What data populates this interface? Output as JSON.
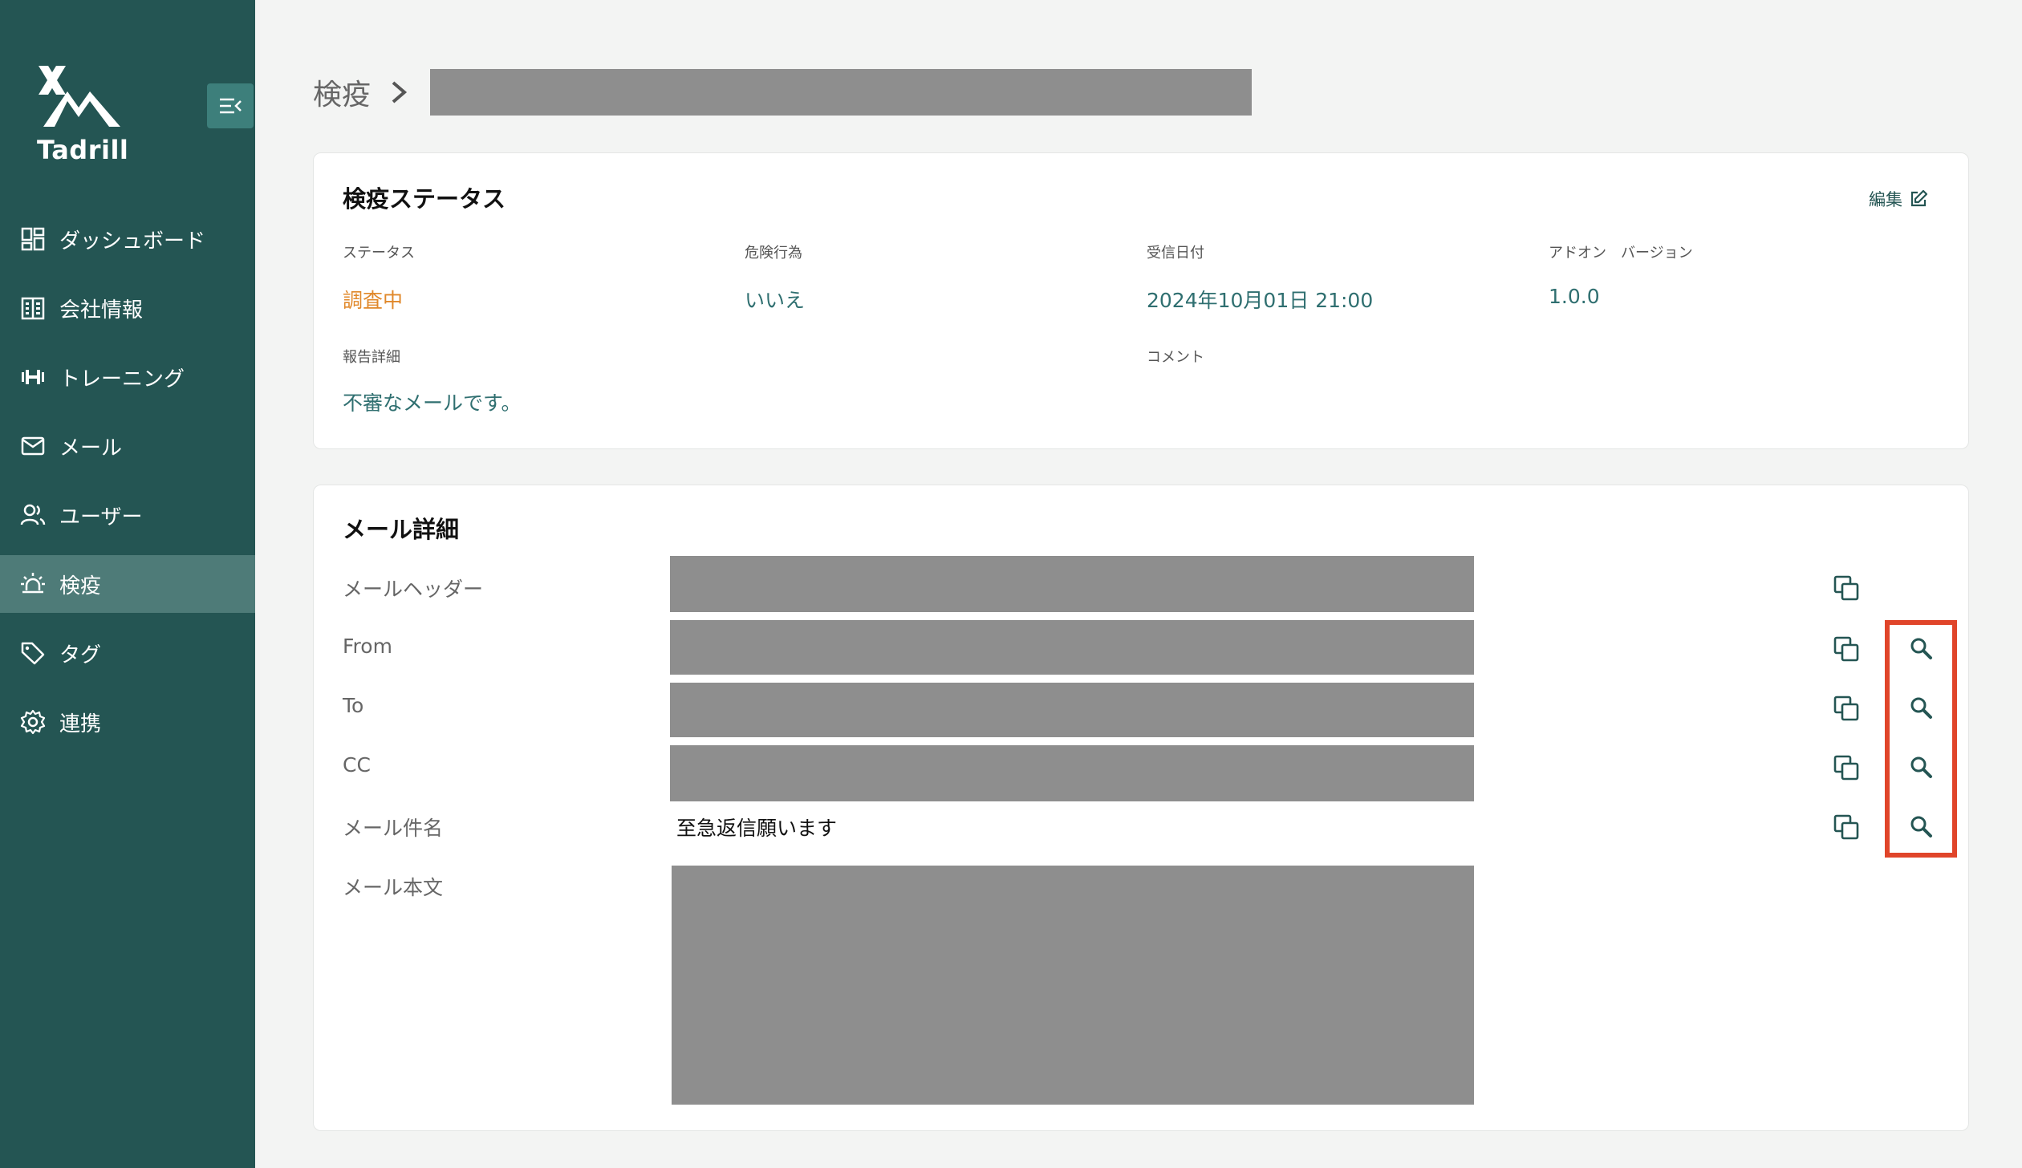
{
  "app": {
    "logo_text": "Tadrill"
  },
  "sidebar": {
    "items": [
      {
        "label": "ダッシュボード",
        "icon": "dashboard-icon"
      },
      {
        "label": "会社情報",
        "icon": "building-icon"
      },
      {
        "label": "トレーニング",
        "icon": "dumbbell-icon"
      },
      {
        "label": "メール",
        "icon": "mail-icon"
      },
      {
        "label": "ユーザー",
        "icon": "users-icon"
      },
      {
        "label": "検疫",
        "icon": "alarm-light-icon",
        "active": true
      },
      {
        "label": "タグ",
        "icon": "tag-icon"
      },
      {
        "label": "連携",
        "icon": "gear-icon"
      }
    ]
  },
  "breadcrumb": {
    "root": "検疫"
  },
  "status_card": {
    "title": "検疫ステータス",
    "edit_label": "編集",
    "fields": {
      "status": {
        "label": "ステータス",
        "value": "調査中"
      },
      "danger": {
        "label": "危険行為",
        "value": "いいえ"
      },
      "received": {
        "label": "受信日付",
        "value": "2024年10月01日 21:00"
      },
      "addon": {
        "label": "アドオン　バージョン",
        "value": "1.0.0"
      },
      "report": {
        "label": "報告詳細",
        "value": "不審なメールです。"
      },
      "comment": {
        "label": "コメント",
        "value": ""
      }
    }
  },
  "mail_card": {
    "title": "メール詳細",
    "rows": {
      "header": {
        "label": "メールヘッダー"
      },
      "from": {
        "label": "From"
      },
      "to": {
        "label": "To"
      },
      "cc": {
        "label": "CC"
      },
      "subject": {
        "label": "メール件名",
        "value": "至急返信願います"
      },
      "body": {
        "label": "メール本文"
      }
    }
  },
  "colors": {
    "sidebar": "#245553",
    "accent": "#2f6f70",
    "status_orange": "#e0882a",
    "highlight": "#e0452a",
    "redaction": "#8e8e8e"
  }
}
